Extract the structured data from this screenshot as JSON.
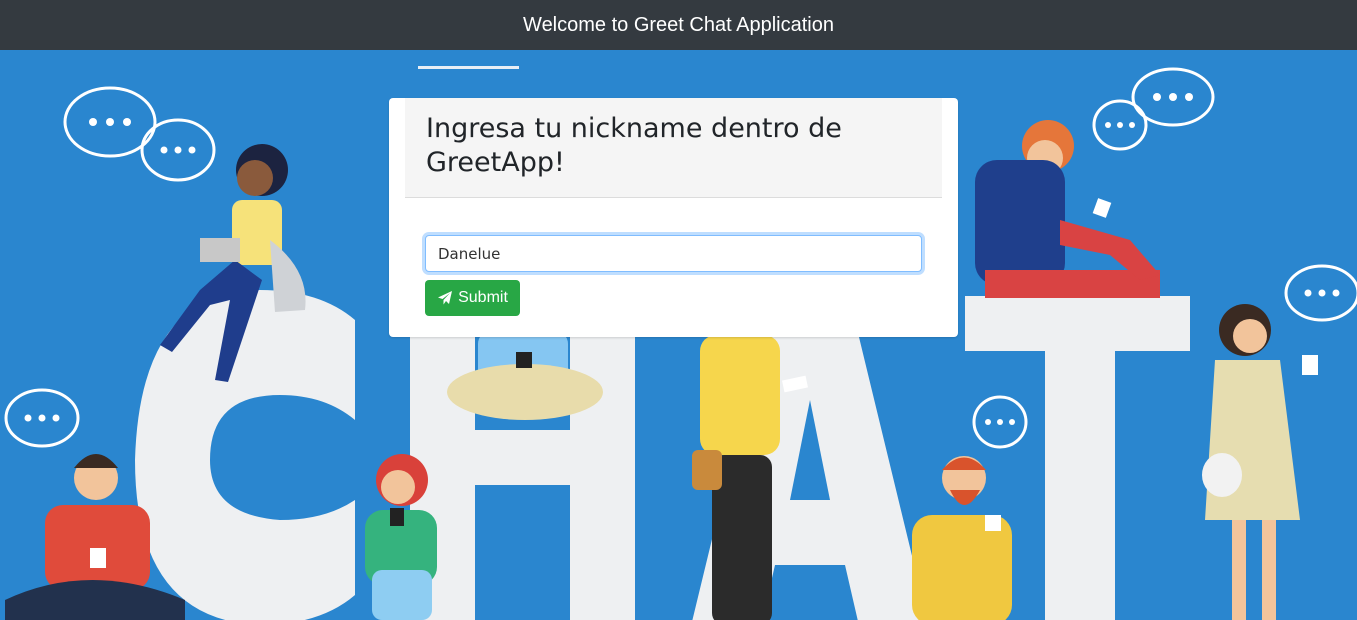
{
  "header": {
    "title": "Welcome to Greet Chat Application"
  },
  "card": {
    "title": "Ingresa tu nickname dentro de GreetApp!",
    "nickname_value": "Danelue",
    "submit_label": "Submit",
    "submit_icon": "paper-plane-icon"
  },
  "background": {
    "watermark_text": "CHAT",
    "description_icons": [
      "chat-bubble-icon",
      "person-illustration"
    ]
  },
  "colors": {
    "header_bg": "#343a40",
    "background_blue": "#2a86cf",
    "submit_green": "#28a745",
    "input_focus": "#80bdff"
  }
}
